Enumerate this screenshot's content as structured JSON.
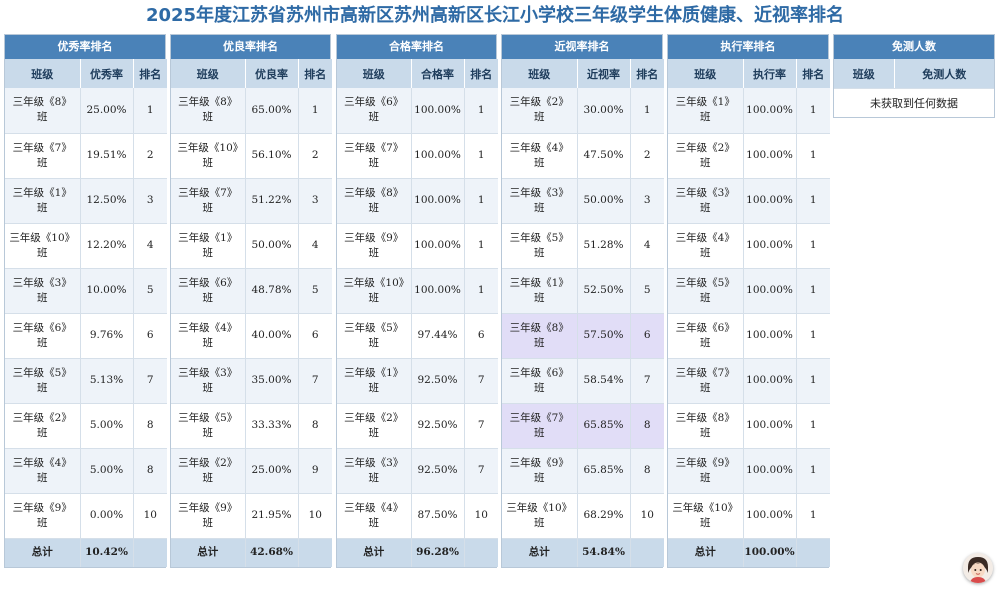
{
  "title": "2025年度江苏省苏州市高新区苏州高新区长江小学校三年级学生体质健康、近视率排名",
  "panels": [
    {
      "title": "优秀率排名",
      "headers": [
        "班级",
        "优秀率",
        "排名"
      ],
      "rows": [
        {
          "cls": "三年级《8》班",
          "rate": "25.00%",
          "rank": "1"
        },
        {
          "cls": "三年级《7》班",
          "rate": "19.51%",
          "rank": "2"
        },
        {
          "cls": "三年级《1》班",
          "rate": "12.50%",
          "rank": "3"
        },
        {
          "cls": "三年级《10》班",
          "rate": "12.20%",
          "rank": "4"
        },
        {
          "cls": "三年级《3》班",
          "rate": "10.00%",
          "rank": "5"
        },
        {
          "cls": "三年级《6》班",
          "rate": "9.76%",
          "rank": "6"
        },
        {
          "cls": "三年级《5》班",
          "rate": "5.13%",
          "rank": "7"
        },
        {
          "cls": "三年级《2》班",
          "rate": "5.00%",
          "rank": "8"
        },
        {
          "cls": "三年级《4》班",
          "rate": "5.00%",
          "rank": "8"
        },
        {
          "cls": "三年级《9》班",
          "rate": "0.00%",
          "rank": "10"
        }
      ],
      "total_label": "总计",
      "total_value": "10.42%"
    },
    {
      "title": "优良率排名",
      "headers": [
        "班级",
        "优良率",
        "排名"
      ],
      "rows": [
        {
          "cls": "三年级《8》班",
          "rate": "65.00%",
          "rank": "1"
        },
        {
          "cls": "三年级《10》班",
          "rate": "56.10%",
          "rank": "2"
        },
        {
          "cls": "三年级《7》班",
          "rate": "51.22%",
          "rank": "3"
        },
        {
          "cls": "三年级《1》班",
          "rate": "50.00%",
          "rank": "4"
        },
        {
          "cls": "三年级《6》班",
          "rate": "48.78%",
          "rank": "5"
        },
        {
          "cls": "三年级《4》班",
          "rate": "40.00%",
          "rank": "6"
        },
        {
          "cls": "三年级《3》班",
          "rate": "35.00%",
          "rank": "7"
        },
        {
          "cls": "三年级《5》班",
          "rate": "33.33%",
          "rank": "8"
        },
        {
          "cls": "三年级《2》班",
          "rate": "25.00%",
          "rank": "9"
        },
        {
          "cls": "三年级《9》班",
          "rate": "21.95%",
          "rank": "10"
        }
      ],
      "total_label": "总计",
      "total_value": "42.68%"
    },
    {
      "title": "合格率排名",
      "headers": [
        "班级",
        "合格率",
        "排名"
      ],
      "rows": [
        {
          "cls": "三年级《6》班",
          "rate": "100.00%",
          "rank": "1"
        },
        {
          "cls": "三年级《7》班",
          "rate": "100.00%",
          "rank": "1"
        },
        {
          "cls": "三年级《8》班",
          "rate": "100.00%",
          "rank": "1"
        },
        {
          "cls": "三年级《9》班",
          "rate": "100.00%",
          "rank": "1"
        },
        {
          "cls": "三年级《10》班",
          "rate": "100.00%",
          "rank": "1"
        },
        {
          "cls": "三年级《5》班",
          "rate": "97.44%",
          "rank": "6"
        },
        {
          "cls": "三年级《1》班",
          "rate": "92.50%",
          "rank": "7"
        },
        {
          "cls": "三年级《2》班",
          "rate": "92.50%",
          "rank": "7"
        },
        {
          "cls": "三年级《3》班",
          "rate": "92.50%",
          "rank": "7"
        },
        {
          "cls": "三年级《4》班",
          "rate": "87.50%",
          "rank": "10"
        }
      ],
      "total_label": "总计",
      "total_value": "96.28%"
    },
    {
      "title": "近视率排名",
      "headers": [
        "班级",
        "近视率",
        "排名"
      ],
      "rows": [
        {
          "cls": "三年级《2》班",
          "rate": "30.00%",
          "rank": "1"
        },
        {
          "cls": "三年级《4》班",
          "rate": "47.50%",
          "rank": "2"
        },
        {
          "cls": "三年级《3》班",
          "rate": "50.00%",
          "rank": "3"
        },
        {
          "cls": "三年级《5》班",
          "rate": "51.28%",
          "rank": "4"
        },
        {
          "cls": "三年级《1》班",
          "rate": "52.50%",
          "rank": "5"
        },
        {
          "cls": "三年级《8》班",
          "rate": "57.50%",
          "rank": "6",
          "highlight": true
        },
        {
          "cls": "三年级《6》班",
          "rate": "58.54%",
          "rank": "7"
        },
        {
          "cls": "三年级《7》班",
          "rate": "65.85%",
          "rank": "8",
          "highlight": true
        },
        {
          "cls": "三年级《9》班",
          "rate": "65.85%",
          "rank": "8"
        },
        {
          "cls": "三年级《10》班",
          "rate": "68.29%",
          "rank": "10"
        }
      ],
      "total_label": "总计",
      "total_value": "54.84%"
    },
    {
      "title": "执行率排名",
      "headers": [
        "班级",
        "执行率",
        "排名"
      ],
      "rows": [
        {
          "cls": "三年级《1》班",
          "rate": "100.00%",
          "rank": "1"
        },
        {
          "cls": "三年级《2》班",
          "rate": "100.00%",
          "rank": "1"
        },
        {
          "cls": "三年级《3》班",
          "rate": "100.00%",
          "rank": "1"
        },
        {
          "cls": "三年级《4》班",
          "rate": "100.00%",
          "rank": "1"
        },
        {
          "cls": "三年级《5》班",
          "rate": "100.00%",
          "rank": "1"
        },
        {
          "cls": "三年级《6》班",
          "rate": "100.00%",
          "rank": "1"
        },
        {
          "cls": "三年级《7》班",
          "rate": "100.00%",
          "rank": "1"
        },
        {
          "cls": "三年级《8》班",
          "rate": "100.00%",
          "rank": "1"
        },
        {
          "cls": "三年级《9》班",
          "rate": "100.00%",
          "rank": "1"
        },
        {
          "cls": "三年级《10》班",
          "rate": "100.00%",
          "rank": "1"
        }
      ],
      "total_label": "总计",
      "total_value": "100.00%"
    }
  ],
  "exempt_panel": {
    "title": "免测人数",
    "headers": [
      "班级",
      "免测人数"
    ],
    "empty_text": "未获取到任何数据"
  },
  "colors": {
    "title": "#2e6aa5",
    "panel_header": "#4a82b8",
    "column_header": "#c9daea",
    "row_stripe": "#eef3f9",
    "row_highlight": "#e1ddf7"
  },
  "avatar_icon": "assistant-avatar-icon"
}
